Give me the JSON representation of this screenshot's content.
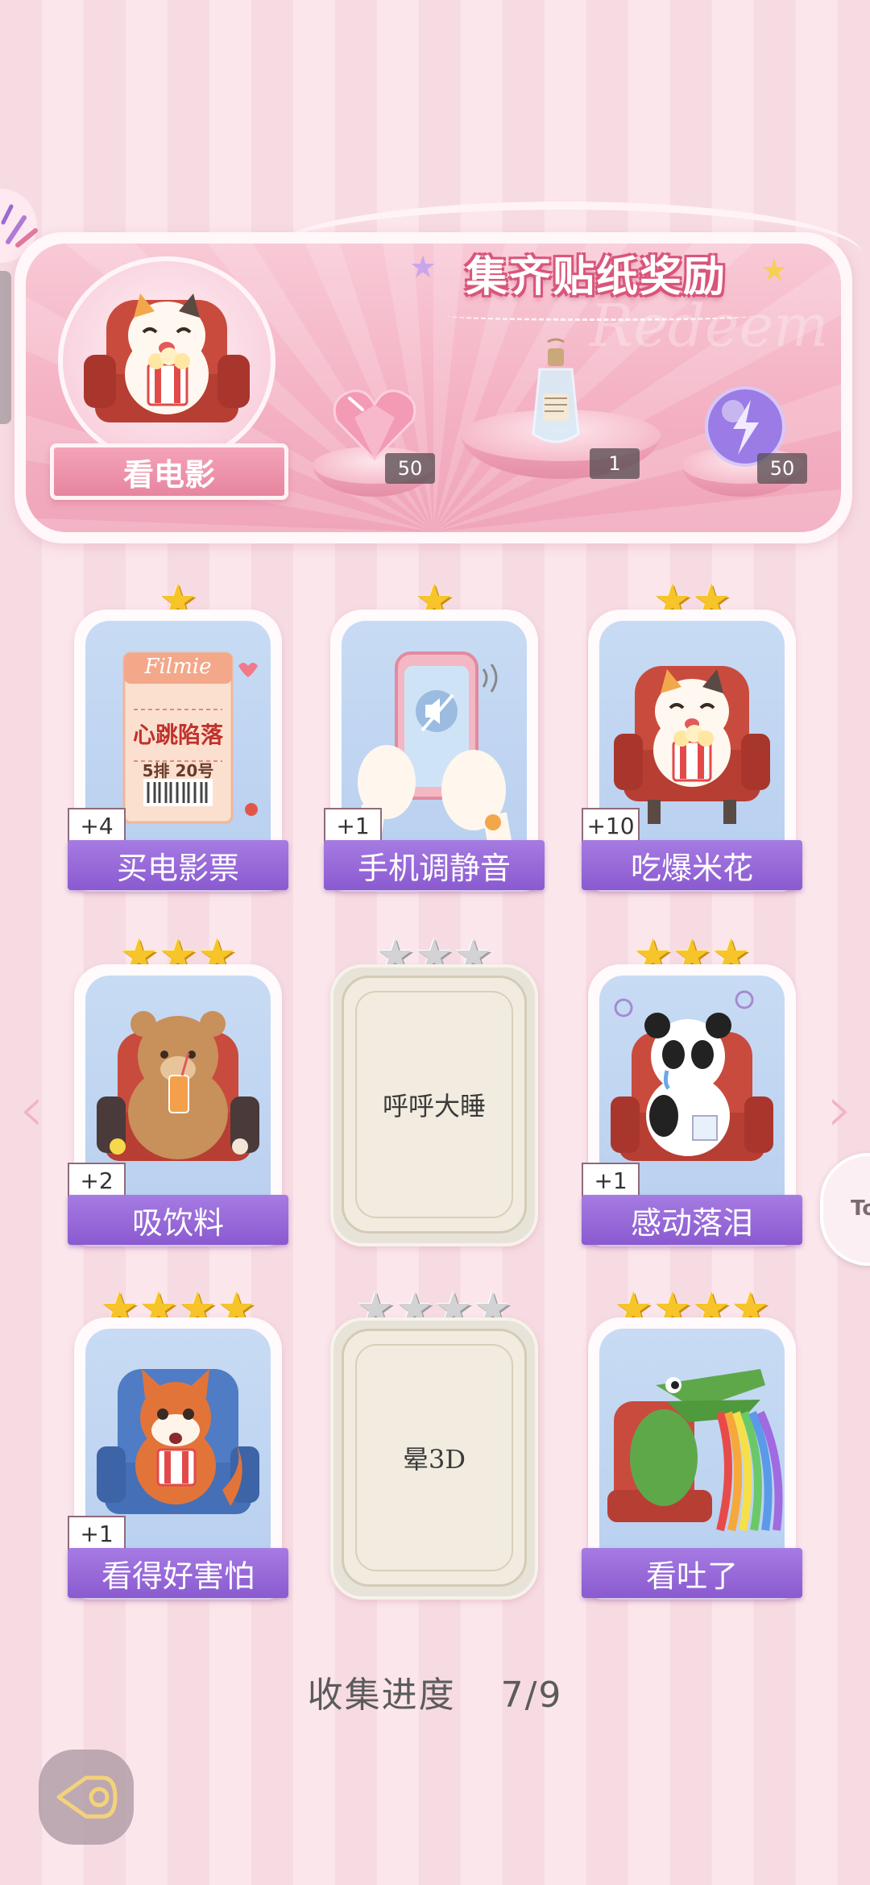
{
  "redeem": {
    "title": "集齐贴纸奖励",
    "mode_label": "看电影",
    "watermark": "Redeem",
    "rewards": [
      {
        "icon": "pink-heart-gem-icon",
        "count": "50"
      },
      {
        "icon": "message-bottle-icon",
        "count": "1"
      },
      {
        "icon": "purple-lightning-orb-icon",
        "count": "50"
      }
    ]
  },
  "stickers": [
    {
      "name": "买电影票",
      "bonus": "+4",
      "stars": 1,
      "unlocked": true,
      "icon": "movie-ticket-icon",
      "ticket": {
        "brand": "Filmie",
        "title": "心跳陷落",
        "seat": "5排 20号"
      }
    },
    {
      "name": "手机调静音",
      "bonus": "+1",
      "stars": 1,
      "unlocked": true,
      "icon": "silent-phone-icon"
    },
    {
      "name": "吃爆米花",
      "bonus": "+10",
      "stars": 2,
      "unlocked": true,
      "icon": "cat-popcorn-icon"
    },
    {
      "name": "吸饮料",
      "bonus": "+2",
      "stars": 3,
      "unlocked": true,
      "icon": "bear-drink-icon"
    },
    {
      "name": "呼呼大睡",
      "bonus": "",
      "stars": 3,
      "unlocked": false,
      "icon": "locked-card-icon"
    },
    {
      "name": "感动落泪",
      "bonus": "+1",
      "stars": 3,
      "unlocked": true,
      "icon": "panda-crying-icon"
    },
    {
      "name": "看得好害怕",
      "bonus": "+1",
      "stars": 4,
      "unlocked": true,
      "icon": "fox-scared-icon"
    },
    {
      "name": "晕3D",
      "bonus": "",
      "stars": 4,
      "unlocked": false,
      "icon": "locked-card-icon"
    },
    {
      "name": "看吐了",
      "bonus": "",
      "stars": 4,
      "unlocked": true,
      "icon": "crocodile-rainbow-icon"
    }
  ],
  "progress": {
    "label": "收集进度",
    "value": "7/9"
  },
  "side_float_text": "To",
  "colors": {
    "accent_pink": "#e7859f",
    "plate_purple": "#8a5ad0",
    "star_gold": "#f7c52a",
    "locked_bg": "#f2ece0"
  }
}
